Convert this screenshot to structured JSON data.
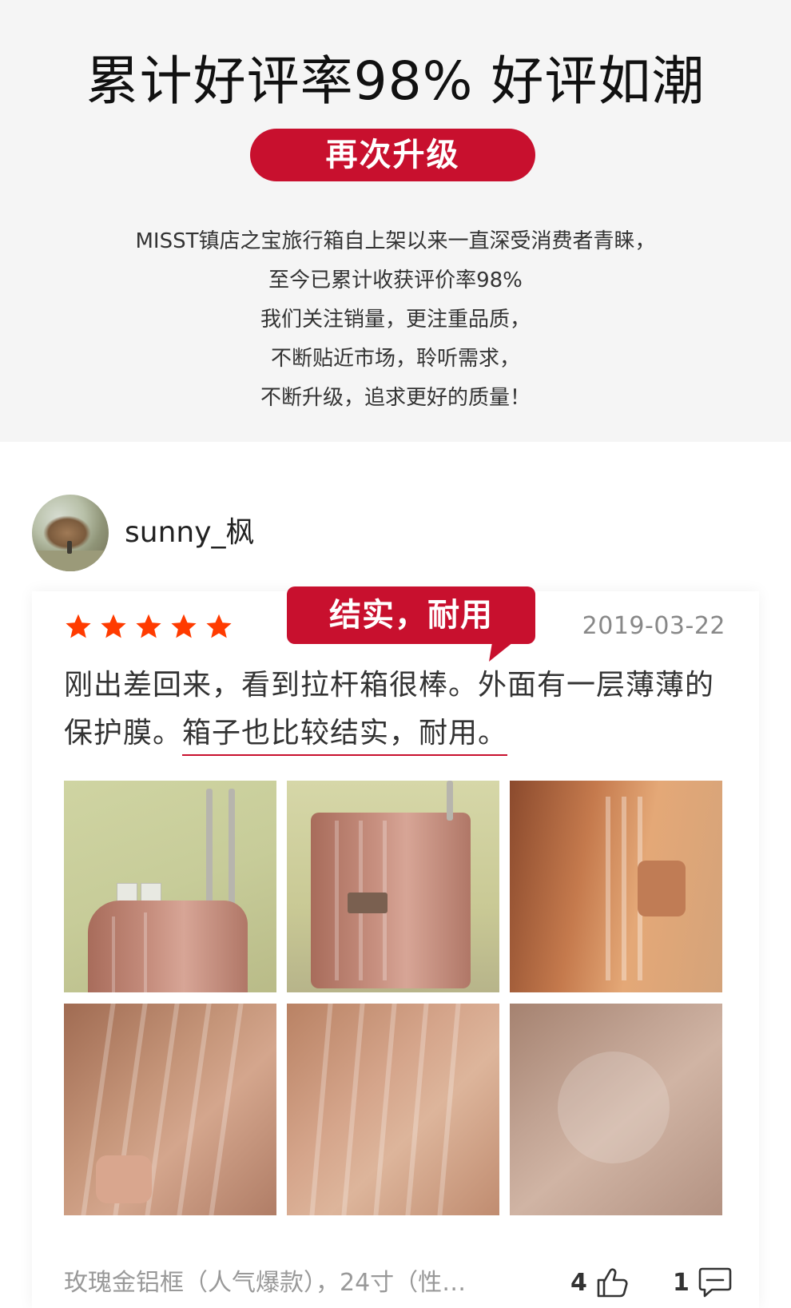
{
  "banner": {
    "title": "累计好评率98%  好评如潮",
    "upgrade_label": "再次升级",
    "description": [
      "MISST镇店之宝旅行箱自上架以来一直深受消费者青睐，",
      "至今已累计收获评价率98%",
      "我们关注销量，更注重品质，",
      "不断贴近市场，聆听需求，",
      "不断升级，追求更好的质量！"
    ]
  },
  "review": {
    "user_name": "sunny_枫",
    "rating": 5,
    "tag": "结实，耐用",
    "date": "2019-03-22",
    "text_plain": "刚出差回来，看到拉杆箱很棒。外面有一层薄薄的保护膜。",
    "text_highlight": "箱子也比较结实，耐用。",
    "photo_count": 6,
    "spec": "玫瑰金铝框（人气爆款），24寸（性…",
    "likes": "4",
    "comments": "1"
  },
  "colors": {
    "accent": "#c8102e",
    "star": "#ff3b00",
    "banner_bg": "#f5f5f5"
  },
  "icons": {
    "rating": "star-icon",
    "like": "thumbs-up-icon",
    "comment": "comment-bubble-icon"
  }
}
